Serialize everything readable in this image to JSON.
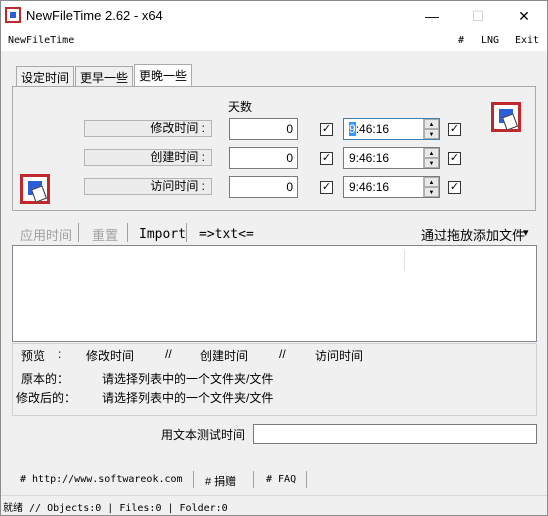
{
  "window": {
    "title": "NewFileTime 2.62 - x64",
    "minimize": "—",
    "maximize": "☐",
    "close": "✕"
  },
  "menu": {
    "app_name": "NewFileTime",
    "hash": "#",
    "lng": "LNG",
    "exit": "Exit"
  },
  "tabs": [
    {
      "label": "设定时间",
      "active": false
    },
    {
      "label": "更早一些",
      "active": false
    },
    {
      "label": "更晚一些",
      "active": true
    }
  ],
  "panel": {
    "days_header": "天数",
    "rows": [
      {
        "label": "修改时间 :",
        "days": "0",
        "days_checked": true,
        "time_selected": "9",
        "time_rest": ":46:16",
        "time_checked": true
      },
      {
        "label": "创建时间 :",
        "days": "0",
        "days_checked": true,
        "time": "9:46:16",
        "time_checked": true
      },
      {
        "label": "访问时间 :",
        "days": "0",
        "days_checked": true,
        "time": "9:46:16",
        "time_checked": true
      }
    ],
    "checkmark": "✓",
    "spin_up": "▲",
    "spin_down": "▼"
  },
  "toolbar": {
    "apply": "应用时间",
    "reset": "重置",
    "import": "Import",
    "to_txt": "=>txt<=",
    "drag_add": "通过拖放添加文件",
    "drag_arrow": "▾"
  },
  "preview": {
    "header_preview": "预览",
    "header_colon": ":",
    "header_modify": "修改时间",
    "header_sep": "//",
    "header_create": "创建时间",
    "header_access": "访问时间",
    "original_label": "原本的：",
    "original_value": "请选择列表中的一个文件夹/文件",
    "modified_label": "修改后的：",
    "modified_value": "请选择列表中的一个文件夹/文件"
  },
  "test": {
    "label": "用文本测试时间",
    "value": ""
  },
  "footer": {
    "website": "# http://www.softwareok.com",
    "donate": "# 捐赠",
    "faq": "# FAQ"
  },
  "status": {
    "text": "就绪 // Objects:0 | Files:0  | Folder:0"
  },
  "colors": {
    "accent": "#3399ff",
    "icon_red": "#c0282d",
    "icon_blue": "#2a5fd8"
  }
}
